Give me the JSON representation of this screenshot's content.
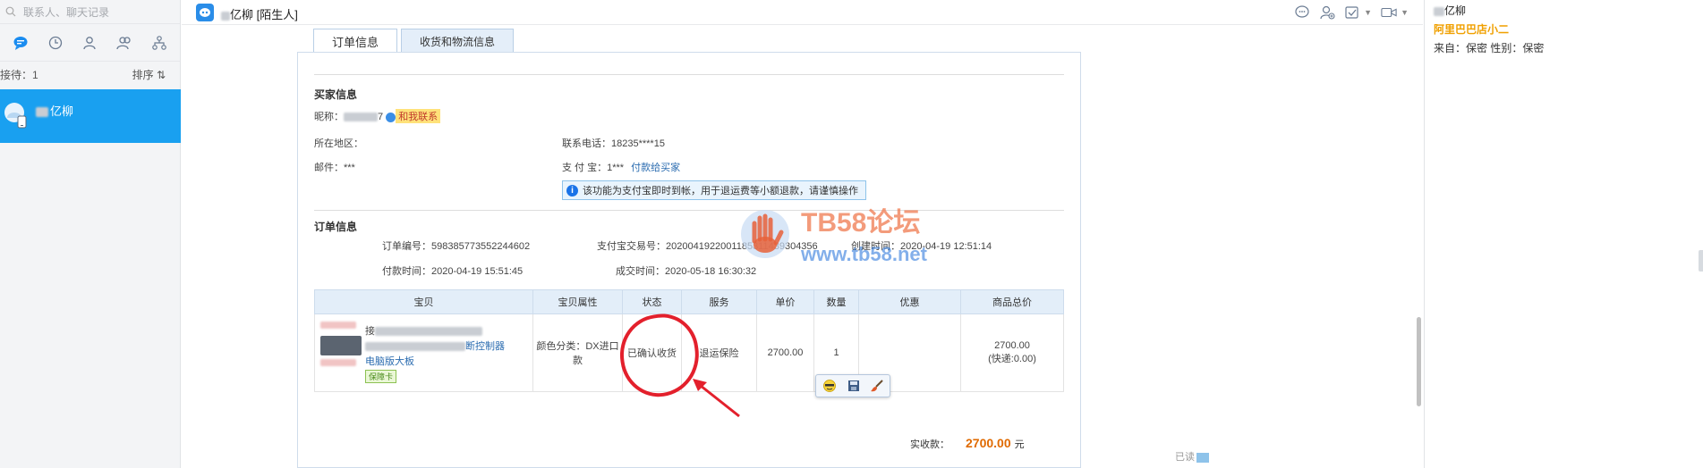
{
  "left": {
    "search_placeholder": "联系人、聊天记录",
    "receiving_label": "接待：1",
    "sort_label": "排序 ⇅",
    "contact": {
      "name": "亿柳"
    }
  },
  "header": {
    "chat_name": "亿柳",
    "chat_tag": "[陌生人]"
  },
  "order": {
    "tabs": [
      "订单信息",
      "收货和物流信息"
    ],
    "buyer": {
      "title": "买家信息",
      "nickname_label": "昵称：",
      "nickname_suffix": "7",
      "contact_tag": "和我联系",
      "region_label": "所在地区：",
      "phone_label": "联系电话：",
      "phone_value": "18235****15",
      "email_label": "邮件：",
      "email_value": "***",
      "alipay_label": "支 付 宝：",
      "alipay_value": "1***",
      "pay_buyer_link": "付款给买家",
      "notice": "该功能为支付宝即时到帐，用于退运费等小额退款，请谨慎操作"
    },
    "info": {
      "title": "订单信息",
      "order_no_label": "订单编号：",
      "order_no": "598385773552244602",
      "alipay_trade_label": "支付宝交易号：",
      "alipay_trade_no": "2020041922001185311439304356",
      "created_label": "创建时间：",
      "created_time": "2020-04-19 12:51:14",
      "paid_label": "付款时间：",
      "paid_time": "2020-04-19 15:51:45",
      "deal_label": "成交时间：",
      "deal_time": "2020-05-18 16:30:32"
    },
    "table": {
      "headers": [
        "宝贝",
        "宝贝属性",
        "状态",
        "服务",
        "单价",
        "数量",
        "优惠",
        "商品总价"
      ],
      "row": {
        "product_line1": "接",
        "product_line2": "断控制器",
        "product_line3": "电脑版大板",
        "badge": "保障卡",
        "attr": "颜色分类：DX进口款",
        "status": "已确认收货",
        "service": "退运保险",
        "unit_price": "2700.00",
        "quantity": "1",
        "discount": "",
        "total": "2700.00",
        "shipping": "(快递:0.00)"
      }
    },
    "paid_label": "实收款：",
    "paid_amount": "2700.00",
    "currency": "元"
  },
  "read_label": "已读",
  "watermark": {
    "line1": "TB58论坛",
    "line2": "www.tb58.net"
  },
  "right": {
    "name": "亿柳",
    "shop": "阿里巴巴店小二",
    "origin": "来自：保密   性别：保密"
  },
  "icons": [
    "search-icon",
    "chat-bubble-icon",
    "clock-icon",
    "person-icon",
    "group-icon",
    "org-icon",
    "avatar-icon",
    "app-logo-icon",
    "emoji-icon",
    "add-user-icon",
    "task-icon",
    "video-icon",
    "info-icon",
    "save-icon",
    "brush-icon"
  ]
}
